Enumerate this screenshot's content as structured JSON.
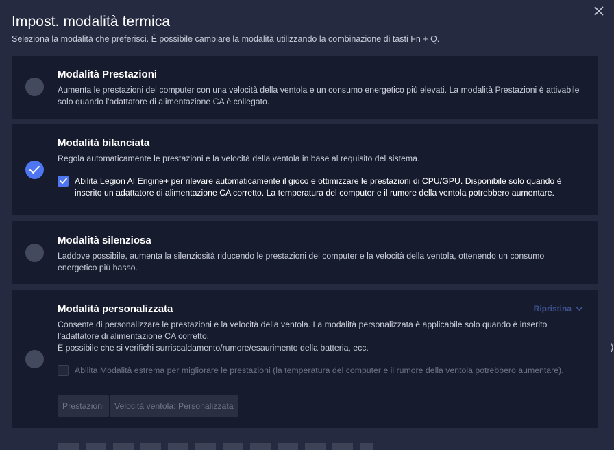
{
  "dialog": {
    "title": "Impost. modalità termica",
    "subtitle": "Seleziona la modalità che preferisci. È possibile cambiare la modalità utilizzando la combinazione di tasti Fn + Q.",
    "close_icon": "close-icon"
  },
  "modes": {
    "performance": {
      "title": "Modalità Prestazioni",
      "description": "Aumenta le prestazioni del computer con una velocità della ventola e un consumo energetico più elevati. La modalità Prestazioni è attivabile solo quando l'adattatore di alimentazione CA è collegato.",
      "selected": false
    },
    "balanced": {
      "title": "Modalità bilanciata",
      "description": "Regola automaticamente le prestazioni e la velocità della ventola in base al requisito del sistema.",
      "selected": true,
      "option_label": "Abilita Legion AI Engine+ per rilevare automaticamente il gioco e ottimizzare le prestazioni di CPU/GPU. Disponibile solo quando è inserito un adattatore di alimentazione CA corretto. La temperatura del computer e il rumore della ventola potrebbero aumentare.",
      "option_checked": true
    },
    "quiet": {
      "title": "Modalità silenziosa",
      "description": "Laddove possibile, aumenta la silenziosità riducendo le prestazioni del computer e la velocità della ventola, ottenendo un consumo energetico più basso.",
      "selected": false
    },
    "custom": {
      "title": "Modalità personalizzata",
      "reset_label": "Ripristina",
      "description": "Consente di personalizzare le prestazioni e la velocità della ventola. La modalità personalizzata è applicabile solo quando è inserito l'adattatore di alimentazione CA corretto.",
      "warning": "È possibile che si verifichi surriscaldamento/rumore/esaurimento della batteria, ecc.",
      "selected": false,
      "option_label": "Abilita Modalità estrema per migliorare le prestazioni (la temperatura del computer e il rumore della ventola potrebbero aumentare).",
      "option_checked": false,
      "buttons": {
        "performance": "Prestazioni",
        "fan_speed": "Velocità ventola: Personalizzata"
      }
    }
  },
  "colors": {
    "accent": "#4d76f0",
    "background": "#252a40",
    "card": "#171b2e"
  }
}
